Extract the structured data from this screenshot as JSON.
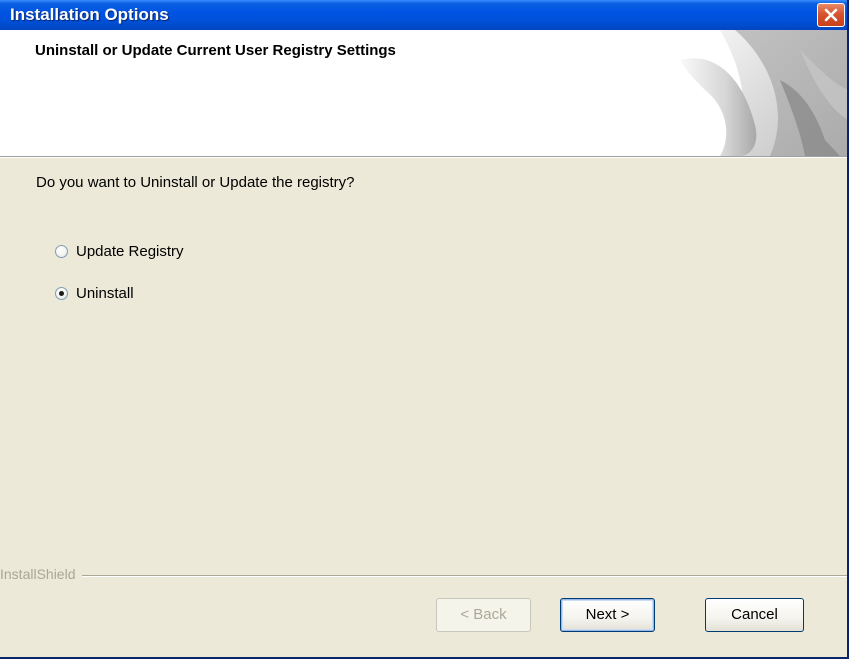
{
  "window": {
    "title": "Installation Options",
    "close_icon": "close-icon"
  },
  "header": {
    "title": "Uninstall or Update Current User Registry Settings",
    "graphic": "page-curl-graphic"
  },
  "body": {
    "question": "Do you want to Uninstall or Update the registry?",
    "options": [
      {
        "label": "Update Registry",
        "selected": false
      },
      {
        "label": "Uninstall",
        "selected": true
      }
    ]
  },
  "footer": {
    "brand": "InstallShield",
    "back_label": "< Back",
    "back_enabled": false,
    "next_label": "Next >",
    "cancel_label": "Cancel"
  },
  "colors": {
    "titlebar": "#0054E3",
    "dialog_bg": "#ECE9D8",
    "close_red": "#D8542E"
  }
}
